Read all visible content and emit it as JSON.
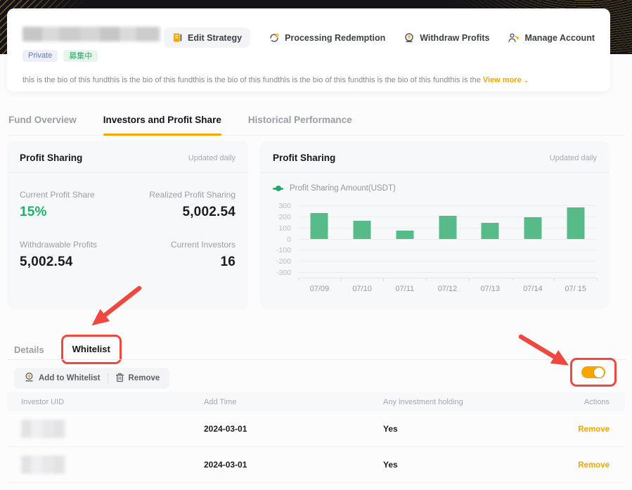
{
  "header": {
    "badges": [
      {
        "label": "Private"
      },
      {
        "label": "募集中"
      }
    ],
    "actions": [
      {
        "label": "Edit Strategy"
      },
      {
        "label": "Processing Redemption"
      },
      {
        "label": "Withdraw Profits"
      },
      {
        "label": "Manage Account"
      }
    ],
    "bio": "this is the bio of this fundthis is the bio of this fundthis is the bio of this fundthis is the bio of this fundthis is the bio of this fundthis is the ",
    "view_more": "View more",
    "view_more_chevron": "⌄"
  },
  "tabs": [
    {
      "label": "Fund Overview",
      "active": false
    },
    {
      "label": "Investors and Profit Share",
      "active": true
    },
    {
      "label": "Historical Performance",
      "active": false
    }
  ],
  "profit_summary": {
    "title": "Profit Sharing",
    "updated": "Updated daily",
    "stats": [
      {
        "label": "Current Profit Share",
        "value": "15%"
      },
      {
        "label": "Realized Profit Sharing",
        "value": "5,002.54"
      },
      {
        "label": "Withdrawable Profits",
        "value": "5,002.54"
      },
      {
        "label": "Current Investors",
        "value": "16"
      }
    ]
  },
  "chart_card": {
    "title": "Profit Sharing",
    "updated": "Updated daily",
    "legend": "Profit Sharing Amount(USDT)"
  },
  "chart_data": {
    "type": "bar",
    "title": "Profit Sharing",
    "legend": [
      "Profit Sharing Amount(USDT)"
    ],
    "categories": [
      "07/09",
      "07/10",
      "07/11",
      "07/12",
      "07/13",
      "07/14",
      "07/ 15"
    ],
    "values": [
      230,
      160,
      70,
      205,
      140,
      195,
      280
    ],
    "xlabel": "",
    "ylabel": "",
    "ylim": [
      -300,
      300
    ],
    "yticks": [
      300,
      200,
      100,
      0,
      -100,
      -200,
      -300
    ],
    "grid": true,
    "bar_color": "#56bb89",
    "legend_position": "top-left"
  },
  "sub_tabs": [
    {
      "label": "Details",
      "active": false
    },
    {
      "label": "Whitelist",
      "active": true
    }
  ],
  "toolbar": {
    "add_label": "Add to Whitelist",
    "remove_label": "Remove",
    "toggle_on": true
  },
  "table": {
    "columns": [
      "Investor UID",
      "Add Time",
      "Any investment holding",
      "Actions"
    ],
    "rows": [
      {
        "add_time": "2024-03-01",
        "holding": "Yes",
        "action": "Remove"
      },
      {
        "add_time": "2024-03-01",
        "holding": "Yes",
        "action": "Remove"
      }
    ]
  },
  "annotations": {
    "arrow_color": "#f0483e",
    "highlight_targets": [
      "whitelist-tab",
      "whitelist-toggle"
    ]
  },
  "colors": {
    "accent_orange": "#f7a600",
    "green_text": "#20b26c",
    "bar_green": "#56bb89",
    "annotation_red": "#f0483e",
    "banner_dark": "#141418",
    "banner_gold": "#b98d1f"
  }
}
